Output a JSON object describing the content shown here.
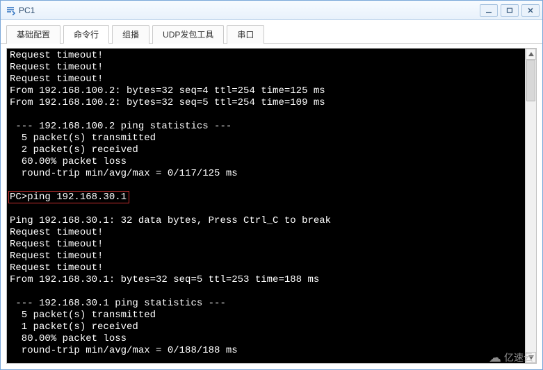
{
  "window": {
    "title": "PC1"
  },
  "tabs": [
    {
      "label": "基础配置"
    },
    {
      "label": "命令行"
    },
    {
      "label": "组播"
    },
    {
      "label": "UDP发包工具"
    },
    {
      "label": "串口"
    }
  ],
  "active_tab_index": 1,
  "terminal": {
    "lines": [
      "Request timeout!",
      "Request timeout!",
      "Request timeout!",
      "From 192.168.100.2: bytes=32 seq=4 ttl=254 time=125 ms",
      "From 192.168.100.2: bytes=32 seq=5 ttl=254 time=109 ms",
      "",
      " --- 192.168.100.2 ping statistics ---",
      "  5 packet(s) transmitted",
      "  2 packet(s) received",
      "  60.00% packet loss",
      "  round-trip min/avg/max = 0/117/125 ms",
      "",
      "PC>ping 192.168.30.1",
      "",
      "Ping 192.168.30.1: 32 data bytes, Press Ctrl_C to break",
      "Request timeout!",
      "Request timeout!",
      "Request timeout!",
      "Request timeout!",
      "From 192.168.30.1: bytes=32 seq=5 ttl=253 time=188 ms",
      "",
      " --- 192.168.30.1 ping statistics ---",
      "  5 packet(s) transmitted",
      "  1 packet(s) received",
      "  80.00% packet loss",
      "  round-trip min/avg/max = 0/188/188 ms"
    ],
    "highlight": {
      "line_index": 12,
      "text": "PC>ping 192.168.30.1"
    }
  },
  "watermark": {
    "text": "亿速云"
  }
}
